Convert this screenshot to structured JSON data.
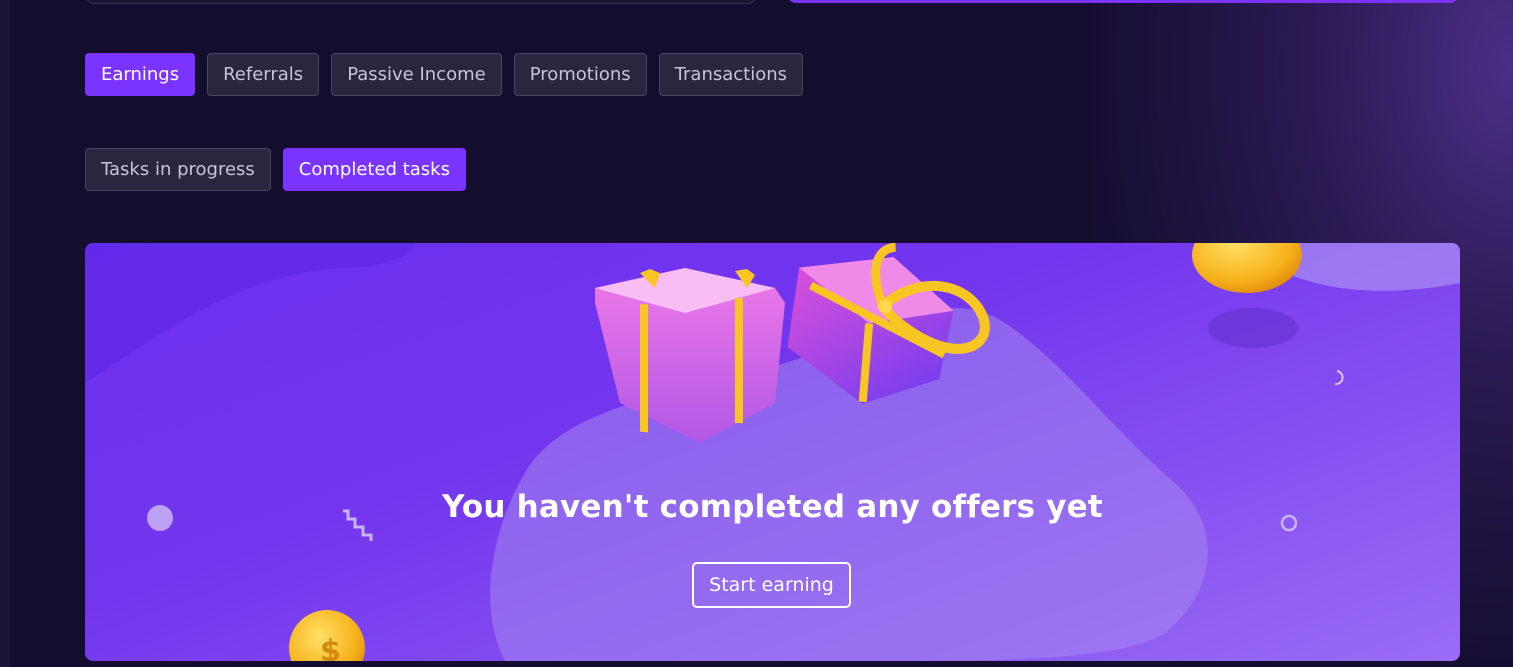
{
  "tabs": [
    {
      "label": "Earnings",
      "active": true
    },
    {
      "label": "Referrals",
      "active": false
    },
    {
      "label": "Passive Income",
      "active": false
    },
    {
      "label": "Promotions",
      "active": false
    },
    {
      "label": "Transactions",
      "active": false
    }
  ],
  "subtabs": [
    {
      "label": "Tasks in progress",
      "active": false
    },
    {
      "label": "Completed tasks",
      "active": true
    }
  ],
  "empty_state": {
    "title": "You haven't completed any offers yet",
    "button_label": "Start earning"
  },
  "colors": {
    "accent": "#7b33ff",
    "background": "#130d2e",
    "tab_inactive": "#2b263f",
    "panel": "#7336ee"
  },
  "icons": [
    "gift-box-open-icon",
    "gift-lid-icon",
    "coin-icon"
  ]
}
